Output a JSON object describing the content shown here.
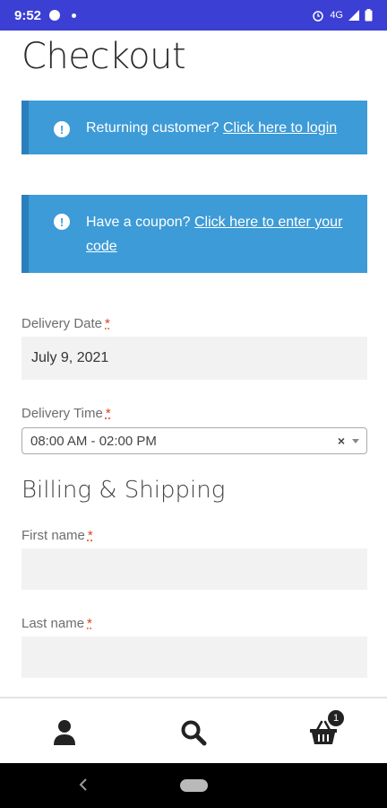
{
  "status": {
    "time": "9:52",
    "network": "4G"
  },
  "page": {
    "title": "Checkout"
  },
  "notices": {
    "login": {
      "text": "Returning customer?",
      "link": "Click here to login"
    },
    "coupon": {
      "text": "Have a coupon?",
      "link": "Click here to enter your code"
    }
  },
  "delivery_date": {
    "label": "Delivery Date",
    "required": "*",
    "value": "July 9, 2021"
  },
  "delivery_time": {
    "label": "Delivery Time",
    "required": "*",
    "value": "08:00 AM - 02:00 PM",
    "clear": "×"
  },
  "billing": {
    "title": "Billing & Shipping",
    "first_name": {
      "label": "First name",
      "required": "*",
      "value": ""
    },
    "last_name": {
      "label": "Last name",
      "required": "*",
      "value": ""
    }
  },
  "bottom_nav": {
    "cart_count": "1"
  },
  "colors": {
    "status_bar": "#3b3fd4",
    "notice": "#3d9bd7",
    "required": "#e2401c"
  }
}
